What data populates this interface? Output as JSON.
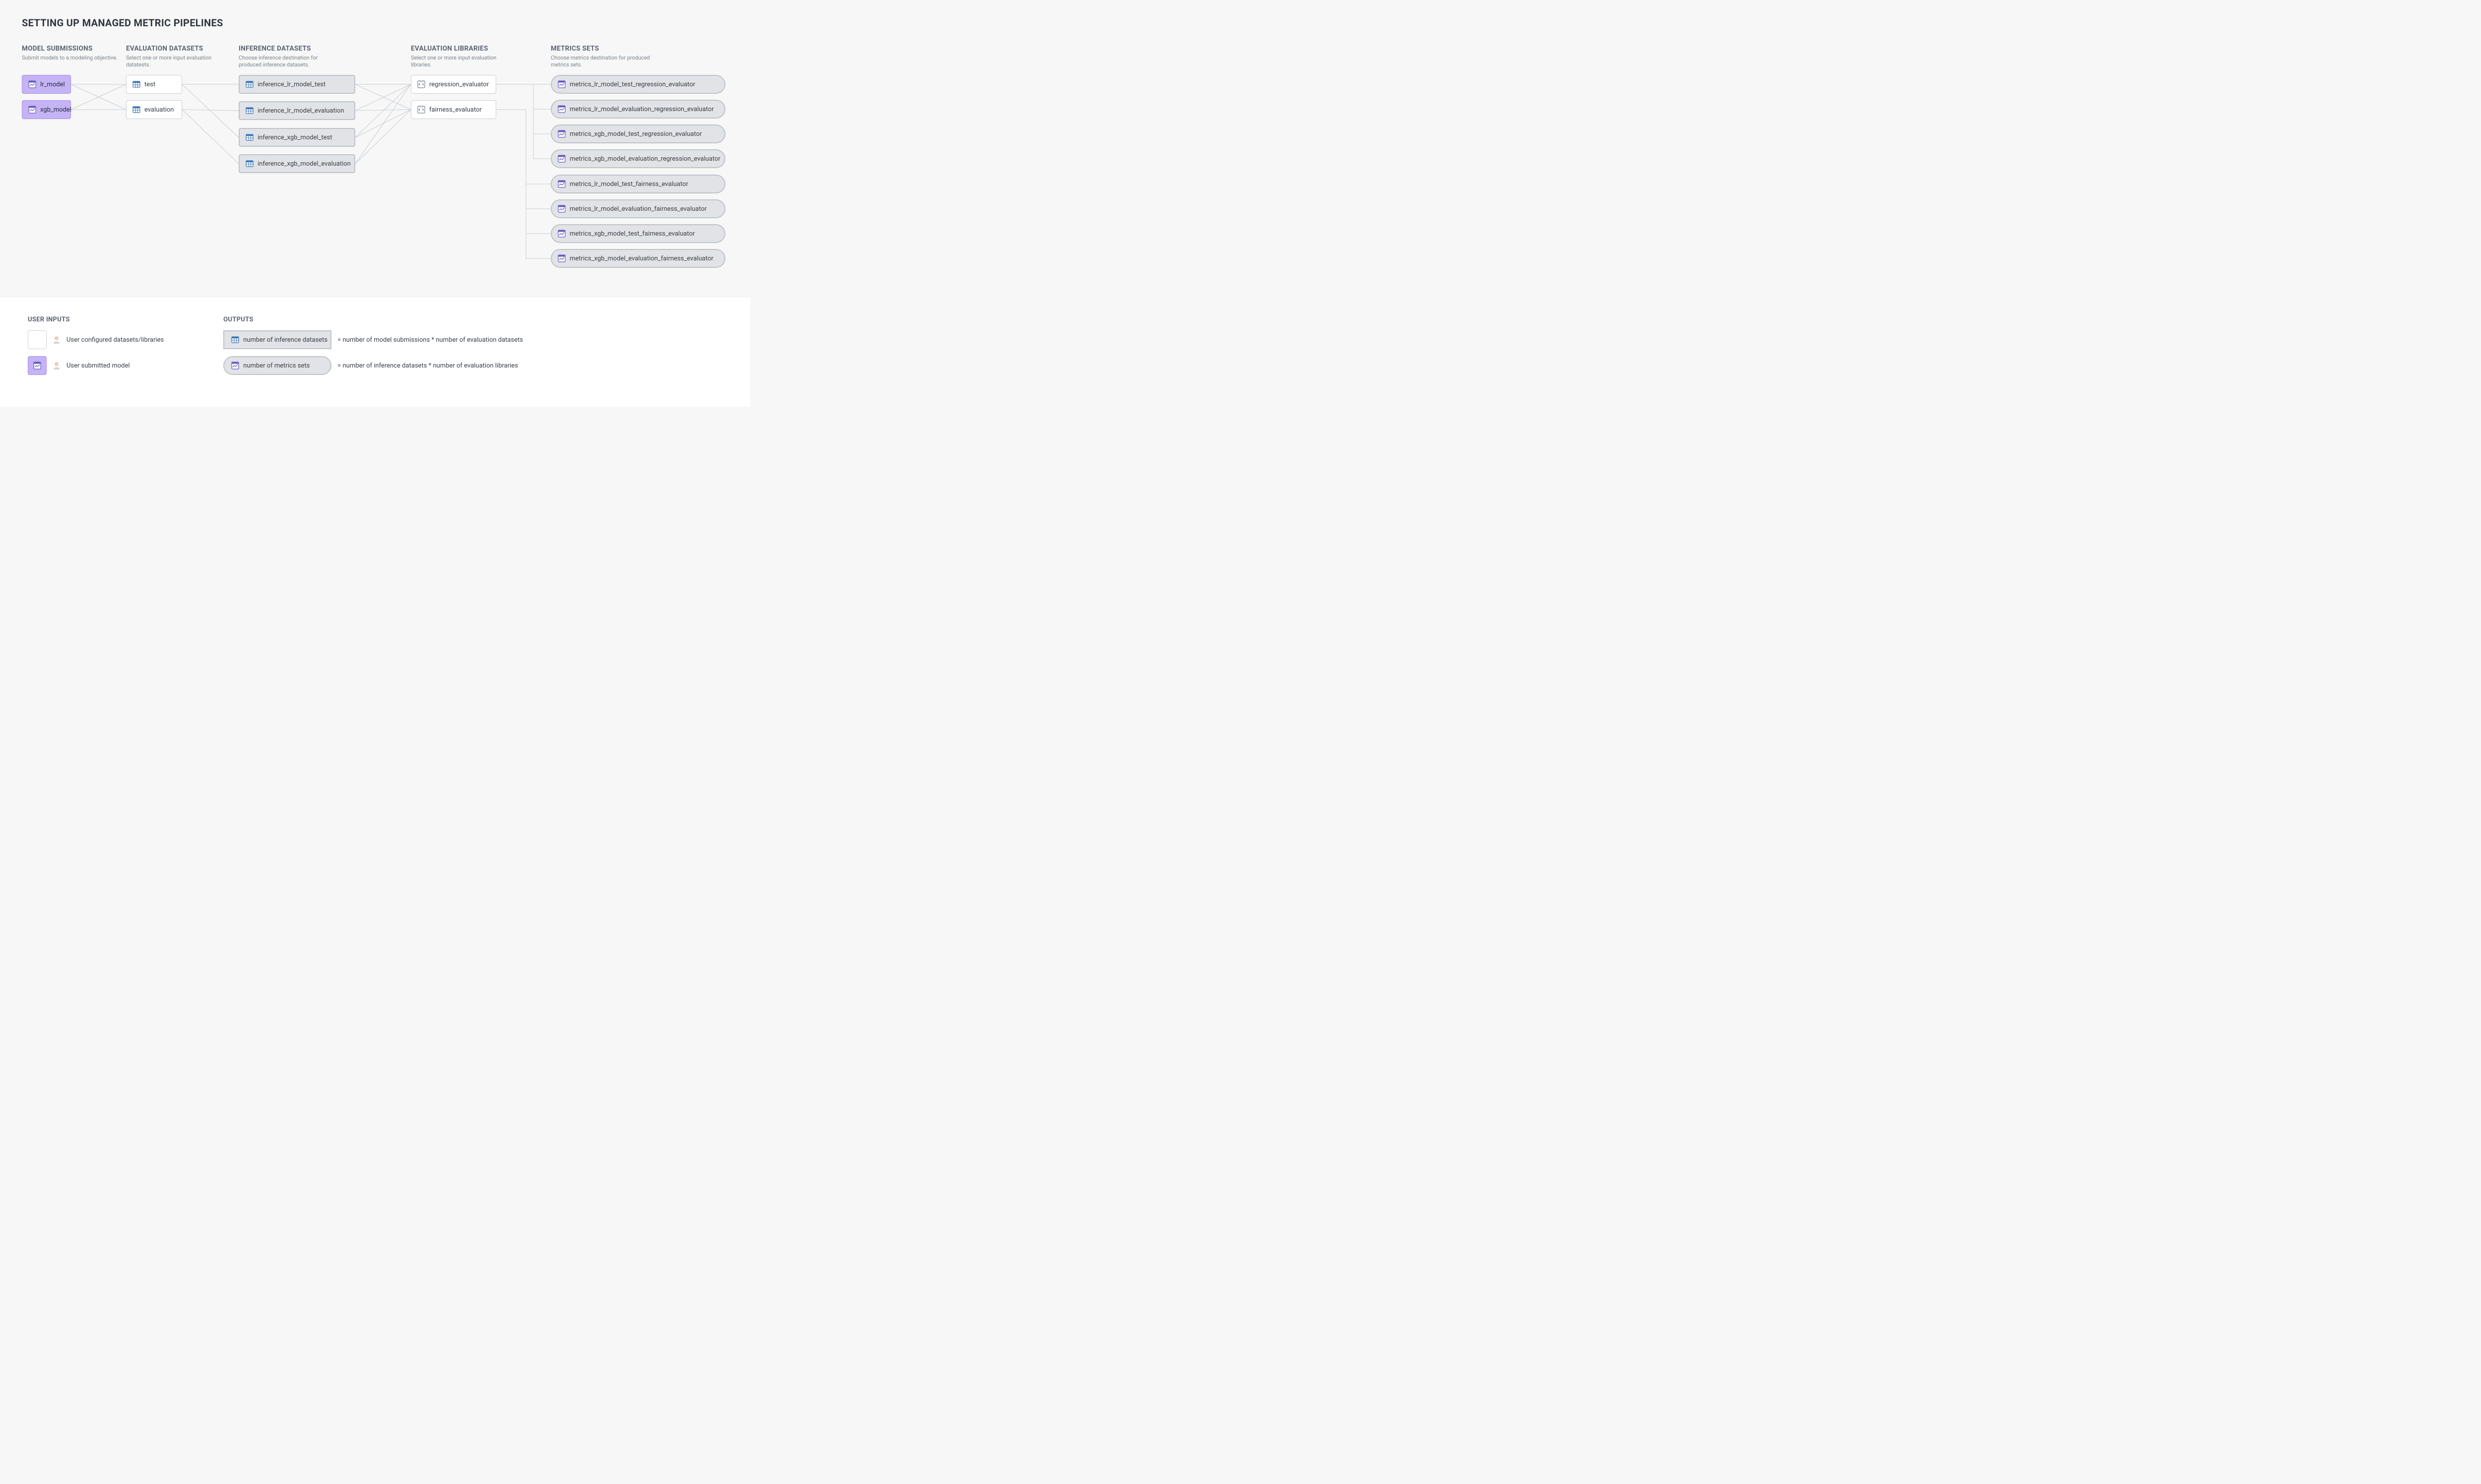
{
  "title": "SETTING UP MANAGED METRIC PIPELINES",
  "columns": {
    "models": {
      "header": "MODEL SUBMISSIONS",
      "sub": "Submit models to a modeling objective."
    },
    "evalds": {
      "header": "EVALUATION DATASETS",
      "sub": "Select one or more input evaluation datatests."
    },
    "inference": {
      "header": "INFERENCE DATASETS",
      "sub": "Choose inference destination for produced inference datasets."
    },
    "evallibs": {
      "header": "EVALUATION LIBRARIES",
      "sub": "Select one or more input evaluation libraries."
    },
    "metrics": {
      "header": "METRICS SETS",
      "sub": "Choose metrics destination for produced metrics sets."
    }
  },
  "models": [
    "lr_model",
    "xgb_model"
  ],
  "eval_datasets": [
    "test",
    "evaluation"
  ],
  "inference_datasets": [
    "inference_lr_model_test",
    "inference_lr_model_evaluation",
    "inference_xgb_model_test",
    "inference_xgb_model_evaluation"
  ],
  "eval_libraries": [
    "regression_evaluator",
    "fairness_evaluator"
  ],
  "metrics_sets": [
    "metrics_lr_model_test_regression_evaluator",
    "metrics_lr_model_evaluation_regression_evaluator",
    "metrics_xgb_model_test_regression_evaluator",
    "metrics_xgb_model_evaluation_regression_evaluator",
    "metrics_lr_model_test_fairness_evaluator",
    "metrics_lr_model_evaluation_fairness_evaluator",
    "metrics_xgb_model_test_fairness_evaluator",
    "metrics_xgb_model_evaluation_fairness_evaluator"
  ],
  "legend": {
    "user_inputs_title": "USER INPUTS",
    "outputs_title": "OUTPUTS",
    "user_configured": "User configured datasets/libraries",
    "user_submitted": "User submitted model",
    "inf_label": "number of inference datasets",
    "inf_formula": "= number of model submissions * number of evaluation datasets",
    "met_label": "number of metrics sets",
    "met_formula": "= number of inference datasets * number of evaluation libraries"
  }
}
